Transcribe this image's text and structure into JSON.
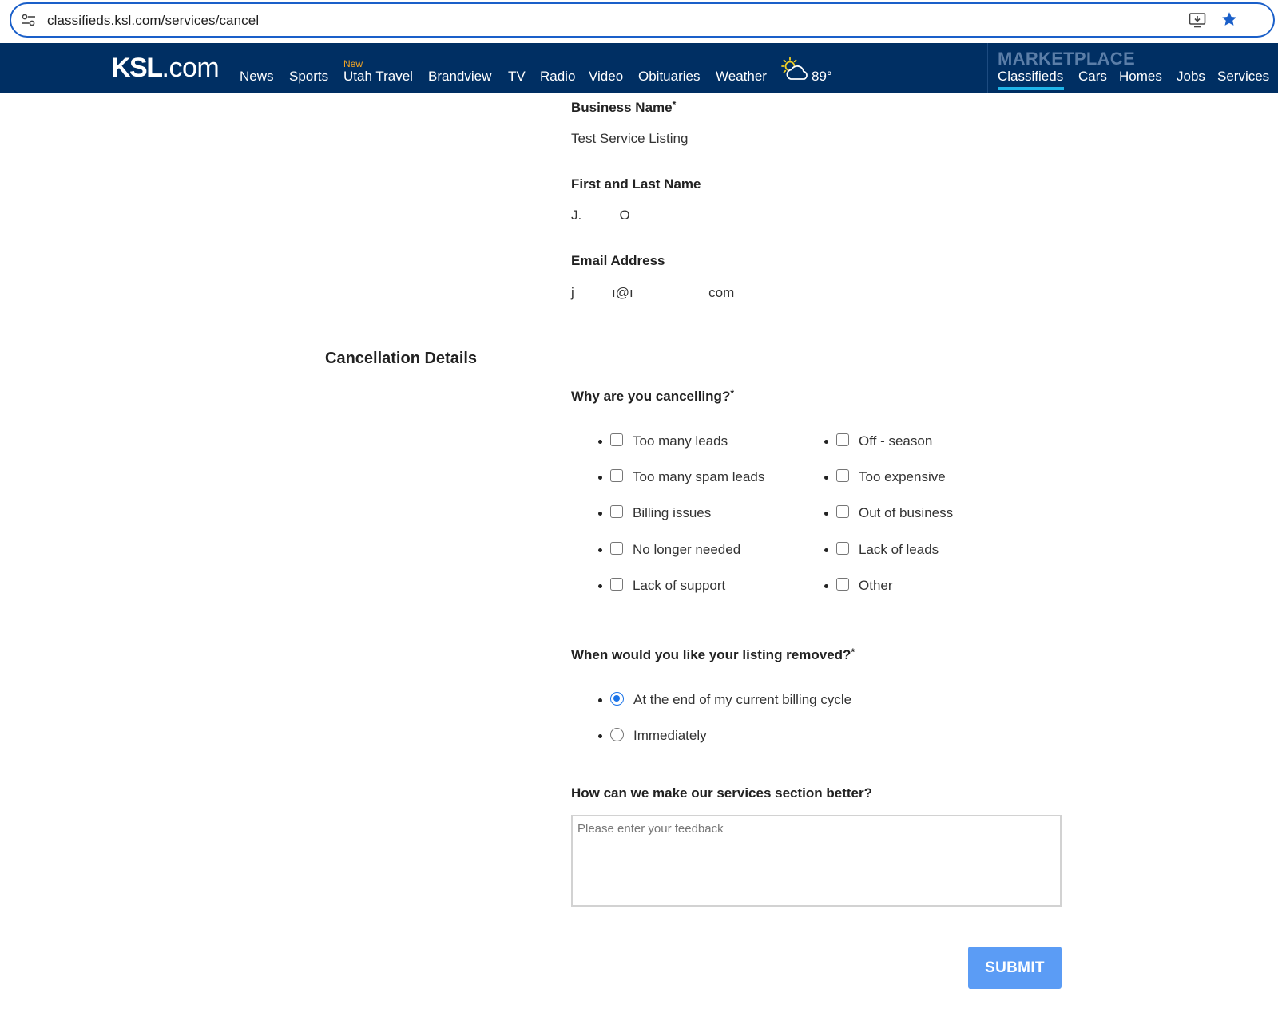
{
  "browser": {
    "url": "classifieds.ksl.com/services/cancel"
  },
  "nav": {
    "logo_main": "KSL",
    "logo_suffix": ".com",
    "new_badge": "New",
    "items": [
      "News",
      "Sports",
      "Utah Travel",
      "Brandview",
      "TV",
      "Radio",
      "Video",
      "Obituaries",
      "Weather"
    ],
    "weather_temp": "89°",
    "marketplace_label": "MARKETPLACE",
    "marketplace_items": [
      "Classifieds",
      "Cars",
      "Homes",
      "Jobs",
      "Services"
    ],
    "marketplace_active": "Classifieds"
  },
  "contact": {
    "business_name_label": "Business Name",
    "business_name_value": "Test Service Listing",
    "name_label": "First and Last Name",
    "name_value": "J.          O",
    "email_label": "Email Address",
    "email_value": "j          ı@ı                    com"
  },
  "cancellation": {
    "section_title": "Cancellation Details",
    "reasons_label": "Why are you cancelling?",
    "reasons_left": [
      "Too many leads",
      "Too many spam leads",
      "Billing issues",
      "No longer needed",
      "Lack of support"
    ],
    "reasons_right": [
      "Off - season",
      "Too expensive",
      "Out of business",
      "Lack of leads",
      "Other"
    ],
    "removal_label": "When would you like your listing removed?",
    "removal_options": [
      "At the end of my current billing cycle",
      "Immediately"
    ],
    "removal_selected": "At the end of my current billing cycle",
    "feedback_label": "How can we make our services section better?",
    "feedback_placeholder": "Please enter your feedback",
    "submit_label": "SUBMIT",
    "required_mark": "*"
  },
  "colors": {
    "nav_bg": "#002f63",
    "accent_blue": "#1a73e8",
    "submit_bg": "#5b9cf5",
    "new_badge": "#f5a623",
    "active_underline": "#1fb5e9"
  }
}
